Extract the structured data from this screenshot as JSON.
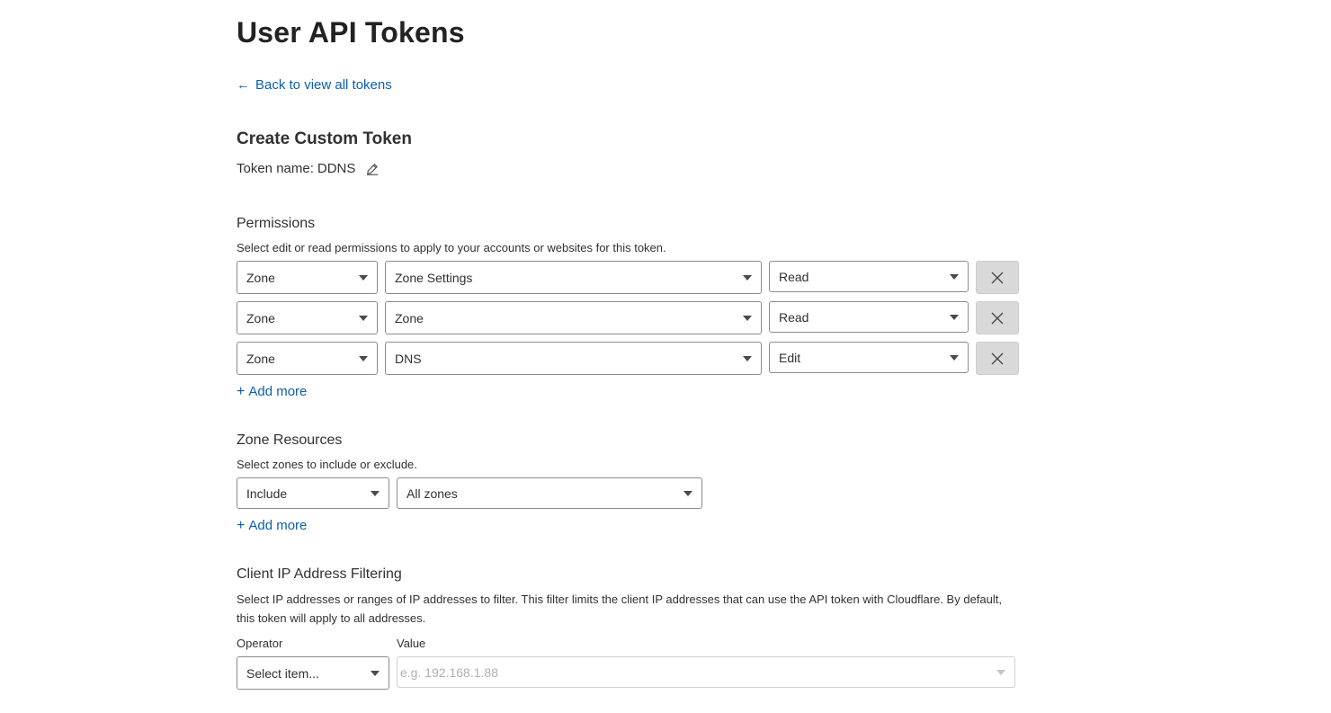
{
  "page": {
    "title": "User API Tokens",
    "back_link": "Back to view all tokens",
    "section_title": "Create Custom Token",
    "token_name_label": "Token name:",
    "token_name_value": "DDNS"
  },
  "permissions": {
    "heading": "Permissions",
    "description": "Select edit or read permissions to apply to your accounts or websites for this token.",
    "rows": [
      {
        "scope": "Zone",
        "resource": "Zone Settings",
        "access": "Read"
      },
      {
        "scope": "Zone",
        "resource": "Zone",
        "access": "Read"
      },
      {
        "scope": "Zone",
        "resource": "DNS",
        "access": "Edit"
      }
    ],
    "add_more": "Add more"
  },
  "zone_resources": {
    "heading": "Zone Resources",
    "description": "Select zones to include or exclude.",
    "mode": "Include",
    "zones": "All zones",
    "add_more": "Add more"
  },
  "ip_filtering": {
    "heading": "Client IP Address Filtering",
    "description": "Select IP addresses or ranges of IP addresses to filter. This filter limits the client IP addresses that can use the API token with Cloudflare. By default, this token will apply to all addresses.",
    "operator_label": "Operator",
    "operator_value": "Select item...",
    "value_label": "Value",
    "value_placeholder": "e.g. 192.168.1.88"
  },
  "colors": {
    "link": "#0b5fb0",
    "text": "#313131",
    "remove_button_bg": "#d9d9d9"
  },
  "icons": {
    "back": "arrow-left-icon",
    "edit_name": "pencil-icon",
    "remove": "close-icon",
    "add": "plus-icon",
    "dropdown": "chevron-down-icon"
  }
}
